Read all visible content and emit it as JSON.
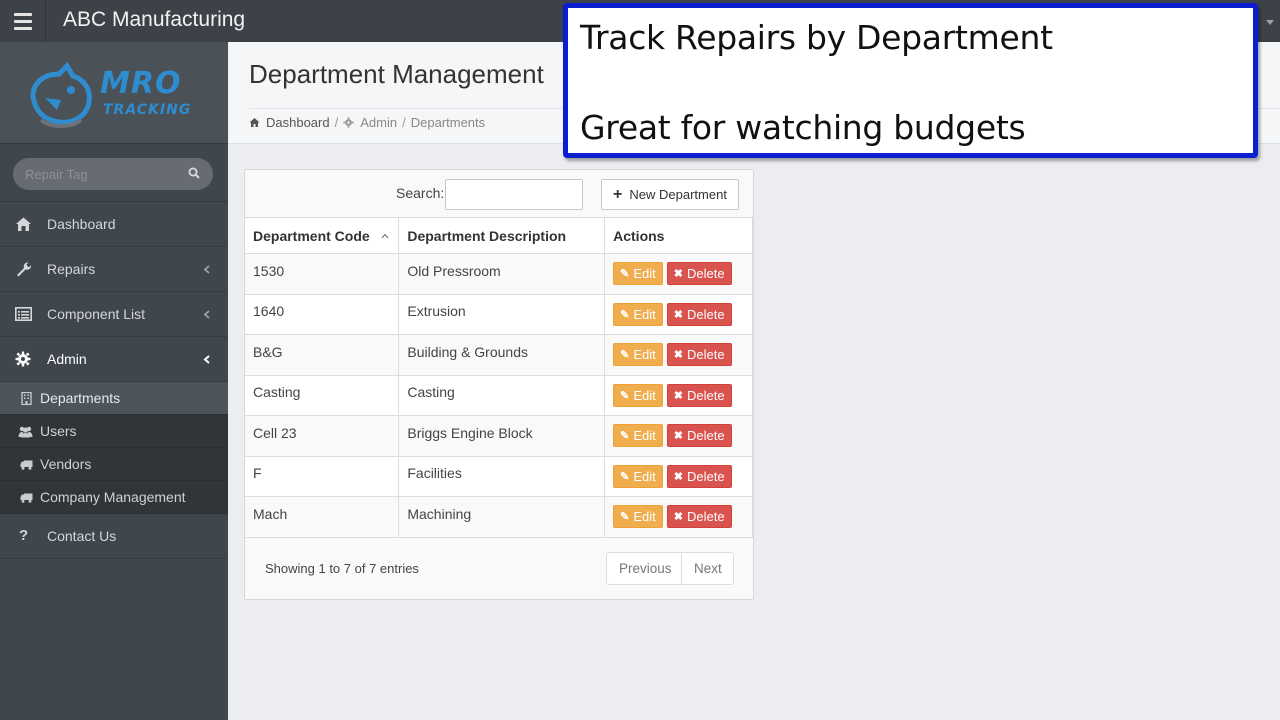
{
  "app": {
    "title": "ABC Manufacturing"
  },
  "logo": {
    "line1": "MRO",
    "line2": "TRACKING",
    "color": "#2f8ccf"
  },
  "sidebar": {
    "search_placeholder": "Repair Tag",
    "items": [
      {
        "label": "Dashboard",
        "icon": "home-icon"
      },
      {
        "label": "Repairs",
        "icon": "wrench-icon"
      },
      {
        "label": "Component List",
        "icon": "list-icon"
      },
      {
        "label": "Admin",
        "icon": "gear-icon"
      }
    ],
    "admin_submenu": [
      {
        "label": "Departments",
        "icon": "building-icon"
      },
      {
        "label": "Users",
        "icon": "users-icon"
      },
      {
        "label": "Vendors",
        "icon": "truck-icon"
      },
      {
        "label": "Company Management",
        "icon": "truck-icon"
      }
    ],
    "contact": {
      "label": "Contact Us",
      "icon": "question-icon"
    }
  },
  "page": {
    "title": "Department Management",
    "breadcrumb": [
      "Dashboard",
      "Admin",
      "Departments"
    ]
  },
  "table": {
    "search_label": "Search:",
    "search_value": "",
    "new_button": "New Department",
    "columns": [
      "Department Code",
      "Department Description",
      "Actions"
    ],
    "rows": [
      {
        "code": "1530",
        "description": "Old Pressroom"
      },
      {
        "code": "1640",
        "description": "Extrusion"
      },
      {
        "code": "B&G",
        "description": "Building & Grounds"
      },
      {
        "code": "Casting",
        "description": "Casting"
      },
      {
        "code": "Cell 23",
        "description": "Briggs Engine Block"
      },
      {
        "code": "F",
        "description": "Facilities"
      },
      {
        "code": "Mach",
        "description": "Machining"
      }
    ],
    "edit_label": "Edit",
    "delete_label": "Delete",
    "info": "Showing 1 to 7 of 7 entries",
    "previous": "Previous",
    "next": "Next"
  },
  "callout": {
    "line1": "Track Repairs by Department",
    "line2": "Great for watching budgets",
    "border_color": "#0c1fd0"
  }
}
